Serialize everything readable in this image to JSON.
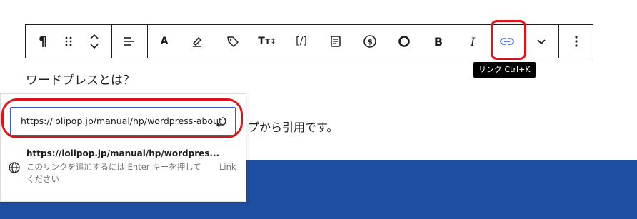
{
  "toolbar": {
    "items": [
      {
        "name": "paragraph-icon",
        "glyph": "¶"
      },
      {
        "name": "drag-handle-icon",
        "glyph": "⠿"
      },
      {
        "name": "move-up-down-icon",
        "glyph": ""
      },
      {
        "name": "align-icon",
        "glyph": ""
      },
      {
        "name": "font-a-icon",
        "glyph": "A"
      },
      {
        "name": "highlight-icon",
        "glyph": ""
      },
      {
        "name": "tag-icon",
        "glyph": ""
      },
      {
        "name": "text-size-icon",
        "glyph": "Tↄ"
      },
      {
        "name": "shortcode-icon",
        "glyph": "[/]"
      },
      {
        "name": "document-icon",
        "glyph": ""
      },
      {
        "name": "dollar-icon",
        "glyph": "$"
      },
      {
        "name": "circle-icon",
        "glyph": ""
      },
      {
        "name": "bold-icon",
        "glyph": "B"
      },
      {
        "name": "italic-icon",
        "glyph": "I"
      },
      {
        "name": "link-icon",
        "glyph": ""
      },
      {
        "name": "chevron-down-icon",
        "glyph": ""
      },
      {
        "name": "more-options-icon",
        "glyph": "⋮"
      }
    ],
    "accent_color": "#3858e9"
  },
  "tooltip": {
    "label": "リンク Ctrl+K"
  },
  "content": {
    "heading": "ワードプレスとは？",
    "paragraph_visible": "プから引用です。"
  },
  "link_popover": {
    "input_value": "https://lolipop.jp/manual/hp/wordpress-about",
    "suggestion_title": "https://lolipop.jp/manual/hp/wordpres...",
    "suggestion_desc": "このリンクを追加するには Enter キーを押してください",
    "suggestion_type": "Link"
  },
  "colors": {
    "highlight": "#e0101a",
    "band": "#1f4fa3"
  }
}
